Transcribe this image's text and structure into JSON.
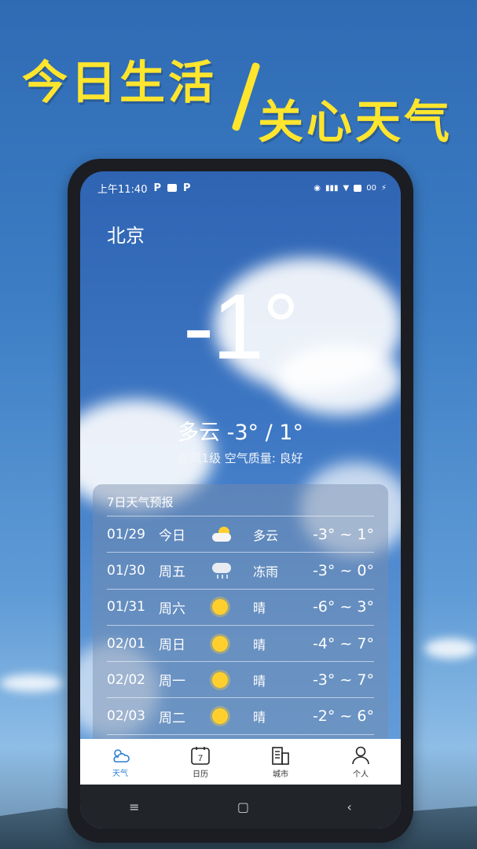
{
  "banner": {
    "line1": "今日生活",
    "line2": "关心天气"
  },
  "status": {
    "time": "上午11:40",
    "battery": "00"
  },
  "weather": {
    "city": "北京",
    "temp": "-1°",
    "condition": "多云 -3° / 1°",
    "details": "东风1级  空气质量: 良好"
  },
  "forecast": {
    "title": "7日天气预报",
    "rows": [
      {
        "date": "01/29",
        "day": "今日",
        "icon": "partly-cloudy-icon",
        "desc": "多云",
        "range": "-3° ~ 1°"
      },
      {
        "date": "01/30",
        "day": "周五",
        "icon": "freezing-rain-icon",
        "desc": "冻雨",
        "range": "-3° ~ 0°"
      },
      {
        "date": "01/31",
        "day": "周六",
        "icon": "sun-icon",
        "desc": "晴",
        "range": "-6° ~ 3°"
      },
      {
        "date": "02/01",
        "day": "周日",
        "icon": "sun-icon",
        "desc": "晴",
        "range": "-4° ~ 7°"
      },
      {
        "date": "02/02",
        "day": "周一",
        "icon": "sun-icon",
        "desc": "晴",
        "range": "-3° ~ 7°"
      },
      {
        "date": "02/03",
        "day": "周二",
        "icon": "sun-icon",
        "desc": "晴",
        "range": "-2° ~ 6°"
      }
    ]
  },
  "tabs": [
    {
      "label": "天气",
      "icon": "weather-icon",
      "active": true
    },
    {
      "label": "日历",
      "icon": "calendar-icon",
      "active": false
    },
    {
      "label": "城市",
      "icon": "building-icon",
      "active": false
    },
    {
      "label": "个人",
      "icon": "person-icon",
      "active": false
    }
  ],
  "calendar_icon_number": "7",
  "nav": {
    "menu": "≡",
    "home": "▢",
    "back": "‹"
  },
  "colors": {
    "banner": "#ffe52e",
    "active_tab": "#2c7fd6",
    "sun": "#ffcf2e"
  }
}
